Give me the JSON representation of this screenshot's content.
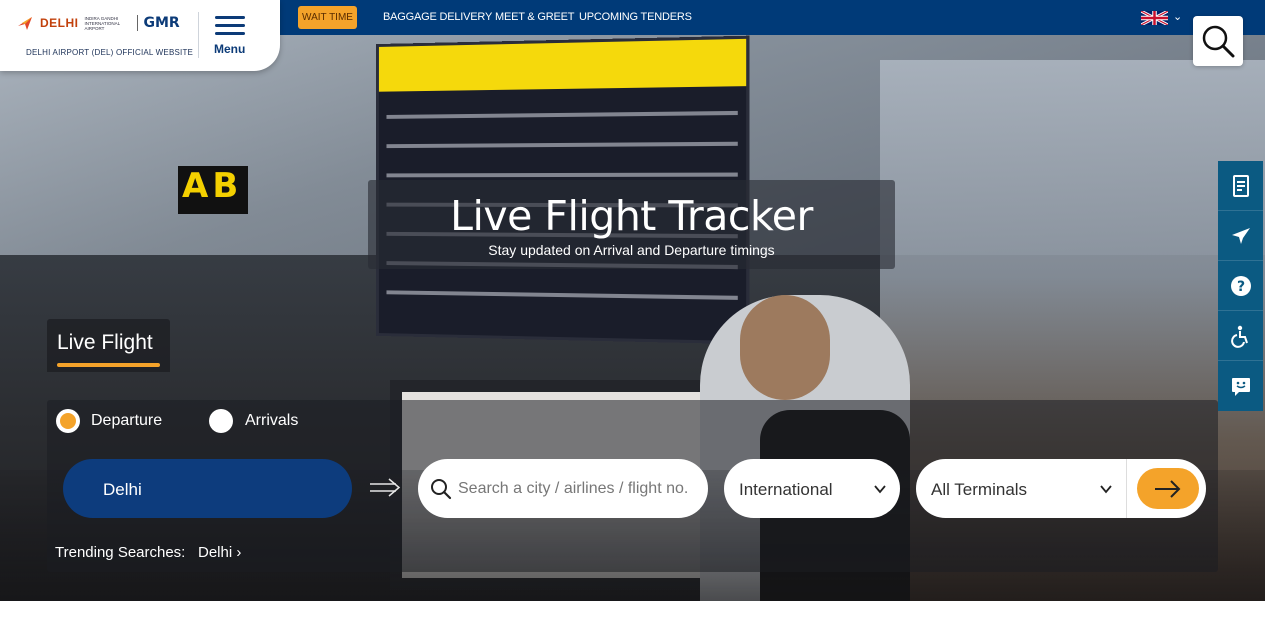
{
  "header": {
    "logo": {
      "brand": "DELHI",
      "airport_name": "INDIRA GANDHI INTERNATIONAL AIRPORT",
      "partner": "GMR",
      "subtitle": "DELHI AIRPORT (DEL) OFFICIAL WEBSITE"
    },
    "menu_label": "Menu",
    "wait_time_label": "WAIT TIME",
    "nav_links": [
      "BAGGAGE DELIVERY",
      "MEET & GREET",
      "UPCOMING TENDERS"
    ],
    "language_icon": "uk-flag-icon",
    "search_icon": "search-icon"
  },
  "side_rail": {
    "items": [
      {
        "icon": "boarding-pass-icon"
      },
      {
        "icon": "airplane-icon"
      },
      {
        "icon": "help-icon"
      },
      {
        "icon": "accessibility-icon"
      },
      {
        "icon": "feedback-icon"
      }
    ]
  },
  "hero": {
    "title": "Live Flight Tracker",
    "subtitle": "Stay updated on Arrival and Departure timings"
  },
  "flight_search": {
    "tab_label": "Live Flight",
    "departure_label": "Departure",
    "arrivals_label": "Arrivals",
    "selected_mode": "Departure",
    "origin": "Delhi",
    "search_placeholder": "Search a city / airlines / flight no.",
    "flight_type": "International",
    "terminal": "All Terminals",
    "trending_label": "Trending Searches:",
    "trending_item": "Delhi"
  },
  "colors": {
    "primary_blue": "#003a78",
    "accent_orange": "#f4a32a",
    "rail_teal": "#0b5a82",
    "origin_blue": "#0d3c7d"
  }
}
